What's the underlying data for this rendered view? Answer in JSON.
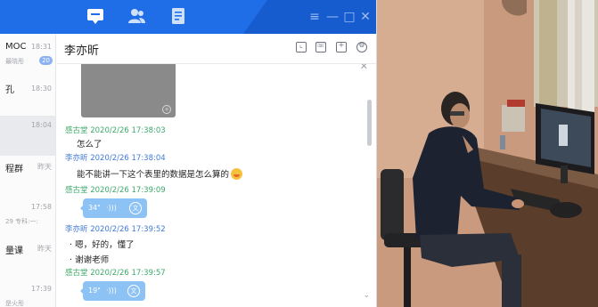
{
  "top_nav": {
    "items": [
      {
        "icon": "chat-bubble-icon",
        "active": true
      },
      {
        "icon": "contacts-icon",
        "active": false
      },
      {
        "icon": "notes-icon",
        "active": false
      }
    ],
    "window_controls": [
      "≡",
      "—",
      "□",
      "✕"
    ]
  },
  "sessions": [
    {
      "name": "MOC",
      "time": "18:31",
      "subtitle": "最晓彤",
      "badge": "20",
      "selected": false
    },
    {
      "name": "孔",
      "time": "18:30",
      "subtitle": "",
      "badge": "",
      "selected": false
    },
    {
      "name": "",
      "time": "18:04",
      "subtitle": "",
      "badge": "",
      "selected": true
    },
    {
      "name": "程群",
      "time": "昨天",
      "subtitle": "",
      "badge": "",
      "selected": false
    },
    {
      "name": "",
      "time": "17:58",
      "subtitle": "29 专科:一:",
      "badge": "",
      "selected": false
    },
    {
      "name": "量课",
      "time": "昨天",
      "subtitle": "",
      "badge": "",
      "selected": false
    },
    {
      "name": "",
      "time": "17:39",
      "subtitle": "是火彤",
      "badge": "",
      "selected": false
    }
  ],
  "chat": {
    "contact_name": "李亦昕",
    "header_icons": [
      "screen-share-icon",
      "phone-icon",
      "add-member-icon",
      "settings-icon"
    ],
    "messages": [
      {
        "sender": "感古堂",
        "time": "2020/2/26 17:38:03",
        "text": "怎么了",
        "color": "green"
      },
      {
        "sender": "李亦昕",
        "time": "2020/2/26 17:38:04",
        "text": "能不能讲一下这个表里的数据是怎么算的",
        "color": "blue",
        "emoji": true
      },
      {
        "sender": "感古堂",
        "time": "2020/2/26 17:39:09",
        "voice": "34\"",
        "color": "green"
      },
      {
        "sender": "李亦昕",
        "time": "2020/2/26 17:39:52",
        "lines": [
          "嗯，好的，懂了",
          "谢谢老师"
        ],
        "color": "blue"
      },
      {
        "sender": "感古堂",
        "time": "2020/2/26 17:39:57",
        "voice": "19\"",
        "color": "green"
      }
    ]
  },
  "colors": {
    "accent": "#1f6ee8",
    "sender_green": "#3aa96a",
    "sender_blue": "#3f79d8",
    "voice_bubble": "#8dc2f5"
  }
}
